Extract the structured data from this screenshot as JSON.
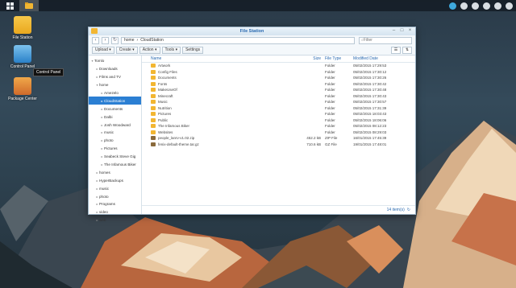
{
  "taskbar": {
    "items": [
      "main-menu-icon",
      "file-station-icon"
    ],
    "right_icons": [
      "dsm-icon",
      "chat-icon",
      "user-icon",
      "search-icon",
      "options-icon",
      "widgets-icon"
    ]
  },
  "desktop": {
    "icons": [
      {
        "label": "File Station"
      },
      {
        "label": "Control Panel"
      },
      {
        "label": "Package Center"
      }
    ],
    "tooltip": "Control Panel"
  },
  "window": {
    "title": "File Station",
    "path": [
      "home",
      "CloudStation"
    ],
    "search_placeholder": "Filter",
    "toolbar": [
      "Upload",
      "Create",
      "Action",
      "Tools",
      "Settings"
    ],
    "tree": [
      {
        "label": "Tomlo",
        "depth": 0,
        "arrow": "▾"
      },
      {
        "label": "Downloads",
        "depth": 1,
        "arrow": "▸"
      },
      {
        "label": "Films and TV",
        "depth": 1,
        "arrow": "▸"
      },
      {
        "label": "home",
        "depth": 1,
        "arrow": "▾"
      },
      {
        "label": "Amezelo",
        "depth": 2,
        "arrow": "▸"
      },
      {
        "label": "CloudStation",
        "depth": 2,
        "arrow": "▸",
        "selected": true
      },
      {
        "label": "Documents",
        "depth": 2,
        "arrow": "▸"
      },
      {
        "label": "Dalbi",
        "depth": 2,
        "arrow": "▸"
      },
      {
        "label": "Josh Woodward",
        "depth": 2,
        "arrow": "▸"
      },
      {
        "label": "music",
        "depth": 2,
        "arrow": "▸"
      },
      {
        "label": "photo",
        "depth": 2,
        "arrow": "▸"
      },
      {
        "label": "Pictures",
        "depth": 2,
        "arrow": "▸"
      },
      {
        "label": "Seabeck Steve Gig",
        "depth": 2,
        "arrow": "▸"
      },
      {
        "label": "The Infamous Biker",
        "depth": 2,
        "arrow": "▸"
      },
      {
        "label": "homes",
        "depth": 1,
        "arrow": "▸"
      },
      {
        "label": "HyperBackups",
        "depth": 1,
        "arrow": "▸"
      },
      {
        "label": "music",
        "depth": 1,
        "arrow": "▸"
      },
      {
        "label": "photo",
        "depth": 1,
        "arrow": "▸"
      },
      {
        "label": "Programs",
        "depth": 1,
        "arrow": "▸"
      },
      {
        "label": "video",
        "depth": 1,
        "arrow": "▸"
      },
      {
        "label": "web",
        "depth": 1,
        "arrow": "▸"
      }
    ],
    "columns": {
      "name": "Name",
      "size": "Size",
      "type": "File Type",
      "date": "Modified Date"
    },
    "files": [
      {
        "name": "Artwork",
        "size": "",
        "type": "Folder",
        "date": "05/02/2015 17:29:53",
        "kind": "folder"
      },
      {
        "name": "Config Files",
        "size": "",
        "type": "Folder",
        "date": "05/02/2015 17:30:12",
        "kind": "folder"
      },
      {
        "name": "Documents",
        "size": "",
        "type": "Folder",
        "date": "05/02/2015 17:30:26",
        "kind": "folder"
      },
      {
        "name": "Fonts",
        "size": "",
        "type": "Folder",
        "date": "05/02/2015 17:30:42",
        "kind": "folder"
      },
      {
        "name": "MakeUseOf",
        "size": "",
        "type": "Folder",
        "date": "05/02/2015 17:30:48",
        "kind": "folder"
      },
      {
        "name": "Minecraft",
        "size": "",
        "type": "Folder",
        "date": "05/02/2015 17:30:43",
        "kind": "folder"
      },
      {
        "name": "Music",
        "size": "",
        "type": "Folder",
        "date": "05/02/2015 17:30:57",
        "kind": "folder"
      },
      {
        "name": "Nutrition",
        "size": "",
        "type": "Folder",
        "date": "05/02/2015 17:31:39",
        "kind": "folder"
      },
      {
        "name": "Pictures",
        "size": "",
        "type": "Folder",
        "date": "05/02/2015 18:03:43",
        "kind": "folder"
      },
      {
        "name": "Public",
        "size": "",
        "type": "Folder",
        "date": "05/02/2015 18:06:06",
        "kind": "folder"
      },
      {
        "name": "The Infamous Biker",
        "size": "",
        "type": "Folder",
        "date": "05/02/2015 08:12:23",
        "kind": "folder"
      },
      {
        "name": "Websites",
        "size": "",
        "type": "Folder",
        "date": "05/02/2015 08:29:03",
        "kind": "folder"
      },
      {
        "name": "people_lanrv-v1.02.zip",
        "size": "452.2 kB",
        "type": "ZIP File",
        "date": "16/01/2015 17:45:39",
        "kind": "zip"
      },
      {
        "name": "fenix-default-theme.tar.gz",
        "size": "710.6 kB",
        "type": "GZ File",
        "date": "19/01/2015 17:48:01",
        "kind": "zip"
      }
    ],
    "status": "14 item(s)"
  }
}
